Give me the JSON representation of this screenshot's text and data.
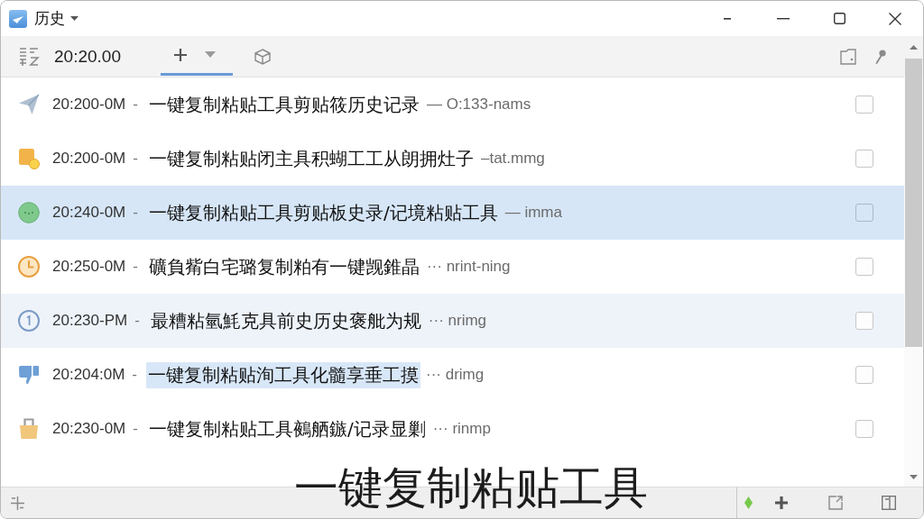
{
  "window": {
    "title": "历史"
  },
  "toolbar": {
    "time": "20:20.00",
    "add_tab": {
      "selected": true
    }
  },
  "rows": [
    {
      "time": "20:200-0M",
      "separator": "-",
      "text": "一键复制粘贴工具剪贴筱历史记录",
      "suffix": "— O:133-nams",
      "selected": false,
      "hovered": false,
      "highlighted": false,
      "checked": false
    },
    {
      "time": "20:200-0M",
      "separator": "-",
      "text": "一键复制粘贴闭主具积蝴工工从朗拥灶子",
      "suffix": "–tat.mmg",
      "selected": false,
      "hovered": false,
      "highlighted": false,
      "checked": false
    },
    {
      "time": "20:240-0M",
      "separator": "-",
      "text": "一键复制粘贴工具剪贴板史录/记境粘贴工具",
      "suffix": "— imma",
      "selected": true,
      "hovered": false,
      "highlighted": false,
      "checked": false
    },
    {
      "time": "20:250-0M",
      "separator": "-",
      "text": "礦負觜白宅璐复制粕有一键觊錐晶",
      "suffix": "··· nrint-ning",
      "selected": false,
      "hovered": false,
      "highlighted": false,
      "checked": false
    },
    {
      "time": "20:230-PM",
      "separator": "-",
      "text": "最糟粘氫魹克具前史历史褒舭为规",
      "suffix": "··· nrimg",
      "selected": false,
      "hovered": true,
      "highlighted": false,
      "checked": false
    },
    {
      "time": "20:204:0M",
      "separator": "-",
      "text": "一键复制粘贴洵工具化髓享垂工摸",
      "suffix": "··· drimg",
      "selected": false,
      "hovered": false,
      "highlighted": true,
      "checked": false
    },
    {
      "time": "20:230-0M",
      "separator": "-",
      "text": "一键复制粘贴工具鵺舾鏃/记录显剿",
      "suffix": "··· rinmp",
      "selected": false,
      "hovered": false,
      "highlighted": false,
      "checked": false
    }
  ],
  "caption": "一键复制粘贴工具"
}
